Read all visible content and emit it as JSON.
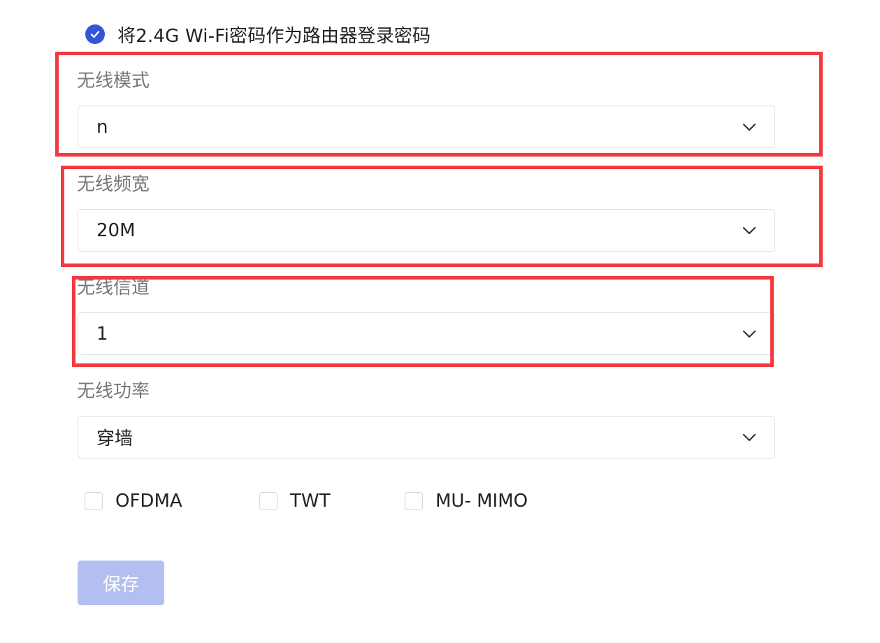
{
  "login_password_option": {
    "label": "将2.4G Wi-Fi密码作为路由器登录密码",
    "checked": true
  },
  "fields": [
    {
      "label": "无线模式",
      "value": "n"
    },
    {
      "label": "无线频宽",
      "value": "20M"
    },
    {
      "label": "无线信道",
      "value": "1"
    },
    {
      "label": "无线功率",
      "value": "穿墙"
    }
  ],
  "options": [
    {
      "label": "OFDMA",
      "checked": false
    },
    {
      "label": "TWT",
      "checked": false
    },
    {
      "label": "MU- MIMO",
      "checked": false
    }
  ],
  "save_button": {
    "label": "保存",
    "disabled": true
  },
  "colors": {
    "accent": "#3355d6",
    "annotation": "#f23a3f",
    "disabled_button": "#b3bff0"
  },
  "icons": {
    "check": "check-icon",
    "dropdown": "chevron-down-icon"
  }
}
